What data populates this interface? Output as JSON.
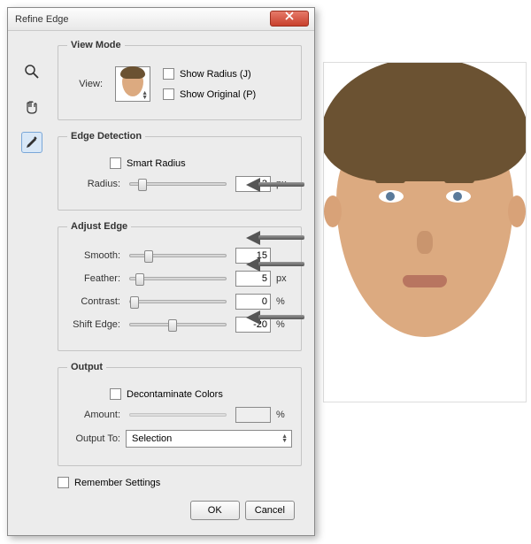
{
  "dialog": {
    "title": "Refine Edge"
  },
  "viewmode": {
    "legend": "View Mode",
    "view_label": "View:",
    "show_radius": "Show Radius (J)",
    "show_original": "Show Original (P)"
  },
  "edge_detection": {
    "legend": "Edge Detection",
    "smart_radius": "Smart Radius",
    "radius_label": "Radius:",
    "radius_value": "3",
    "radius_unit": "px"
  },
  "adjust_edge": {
    "legend": "Adjust Edge",
    "smooth_label": "Smooth:",
    "smooth_value": "15",
    "feather_label": "Feather:",
    "feather_value": "5",
    "feather_unit": "px",
    "contrast_label": "Contrast:",
    "contrast_value": "0",
    "contrast_unit": "%",
    "shift_label": "Shift Edge:",
    "shift_value": "-20",
    "shift_unit": "%"
  },
  "output": {
    "legend": "Output",
    "decontaminate": "Decontaminate Colors",
    "amount_label": "Amount:",
    "amount_value": "",
    "amount_unit": "%",
    "output_to_label": "Output To:",
    "output_to_value": "Selection"
  },
  "footer": {
    "remember": "Remember Settings",
    "ok": "OK",
    "cancel": "Cancel"
  }
}
